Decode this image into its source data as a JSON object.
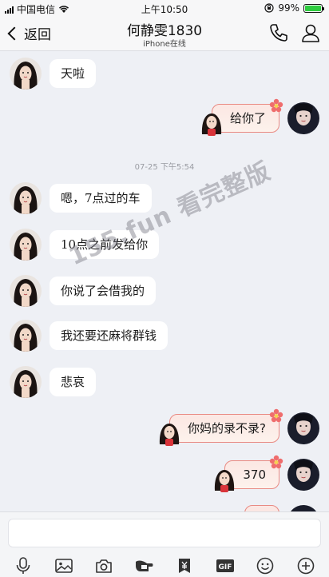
{
  "status_bar": {
    "carrier": "中国电信",
    "time": "上午10:50",
    "battery_percent": "99%",
    "battery_level": 0.99
  },
  "header": {
    "back_label": "返回",
    "title": "何静雯1830",
    "subtitle": "iPhone在线",
    "icons": [
      "phone-icon",
      "profile-icon"
    ]
  },
  "messages": [
    {
      "direction": "in",
      "text": "天啦"
    },
    {
      "direction": "out",
      "text": "给你了"
    },
    {
      "direction": "in",
      "text": "嗯，7点过的车"
    },
    {
      "direction": "in",
      "text": "10点之前发给你"
    },
    {
      "direction": "in",
      "text": "你说了会借我的"
    },
    {
      "direction": "in",
      "text": "我还要还麻将群钱"
    },
    {
      "direction": "in",
      "text": "悲哀"
    },
    {
      "direction": "out",
      "text": "你妈的录不录?"
    },
    {
      "direction": "out",
      "text": "370"
    }
  ],
  "timestamp": "07-25 下午5:54",
  "watermark": "155.fun 看完整版",
  "composer": {
    "input_value": "",
    "toolbar_icons": [
      "microphone-icon",
      "image-icon",
      "camera-icon",
      "hongbao-icon",
      "yuan-transfer-icon",
      "gif-icon",
      "emoji-icon",
      "plus-icon"
    ]
  },
  "colors": {
    "background": "#eef0f5",
    "incoming_bubble": "#ffffff",
    "outgoing_bubble_border": "#e98b84",
    "outgoing_bubble_fill": "#fbe7e3"
  }
}
